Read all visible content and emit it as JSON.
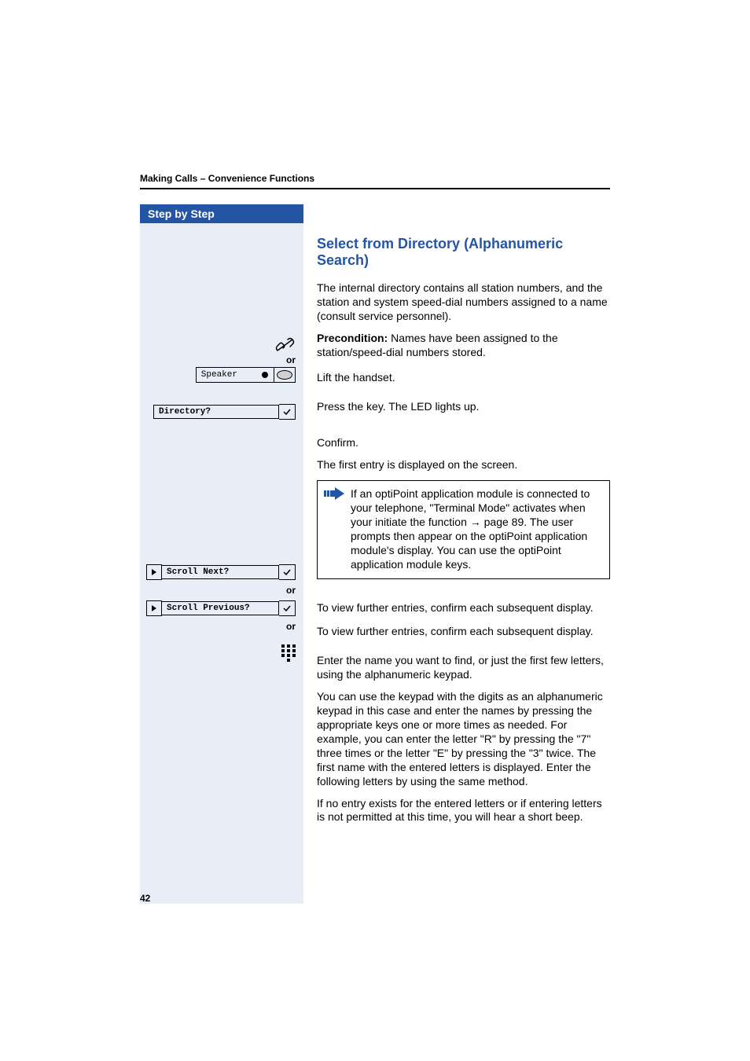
{
  "header": {
    "section_title": "Making Calls – Convenience Functions"
  },
  "sidebar": {
    "title": "Step by Step"
  },
  "left": {
    "or": "or",
    "speaker_key": "Speaker",
    "directory": "Directory?",
    "scroll_next": "Scroll Next?",
    "scroll_previous": "Scroll Previous?"
  },
  "main": {
    "heading": "Select from Directory (Alphanumeric Search)",
    "p1": "The internal directory contains all station numbers, and the station and system speed-dial numbers assigned to a name (consult service personnel).",
    "p2_label": "Precondition:",
    "p2_rest": " Names have been assigned to the station/speed-dial numbers stored.",
    "p3": "Lift the handset.",
    "p4": "Press the key. The LED lights up.",
    "p5": "Confirm.",
    "p6": "The first entry is displayed on the screen.",
    "note": "If an optiPoint application module is connected to your telephone, \"Terminal Mode\" activates when your initiate the function → page 89. The user prompts then appear on the optiPoint application module's display. You can use the optiPoint application module keys.",
    "p7": "To view further entries, confirm each subsequent display.",
    "p8": "To view further entries, confirm each subsequent display.",
    "p9": "Enter the name you want to find, or just the first few letters, using the alphanumeric keypad.",
    "p10": "You can use the keypad with the digits as an alphanumeric keypad in this case and enter the names by pressing the appropriate keys one or more times as needed. For example, you can enter the letter \"R\" by pressing the \"7\" three times or the letter \"E\" by pressing the \"3\" twice. The first name with the entered letters is displayed. Enter the following letters by using the same method.",
    "p11": "If no entry exists for the entered letters or if entering letters is not permitted at this time, you will hear a short beep."
  },
  "footer": {
    "page_number": "42"
  }
}
